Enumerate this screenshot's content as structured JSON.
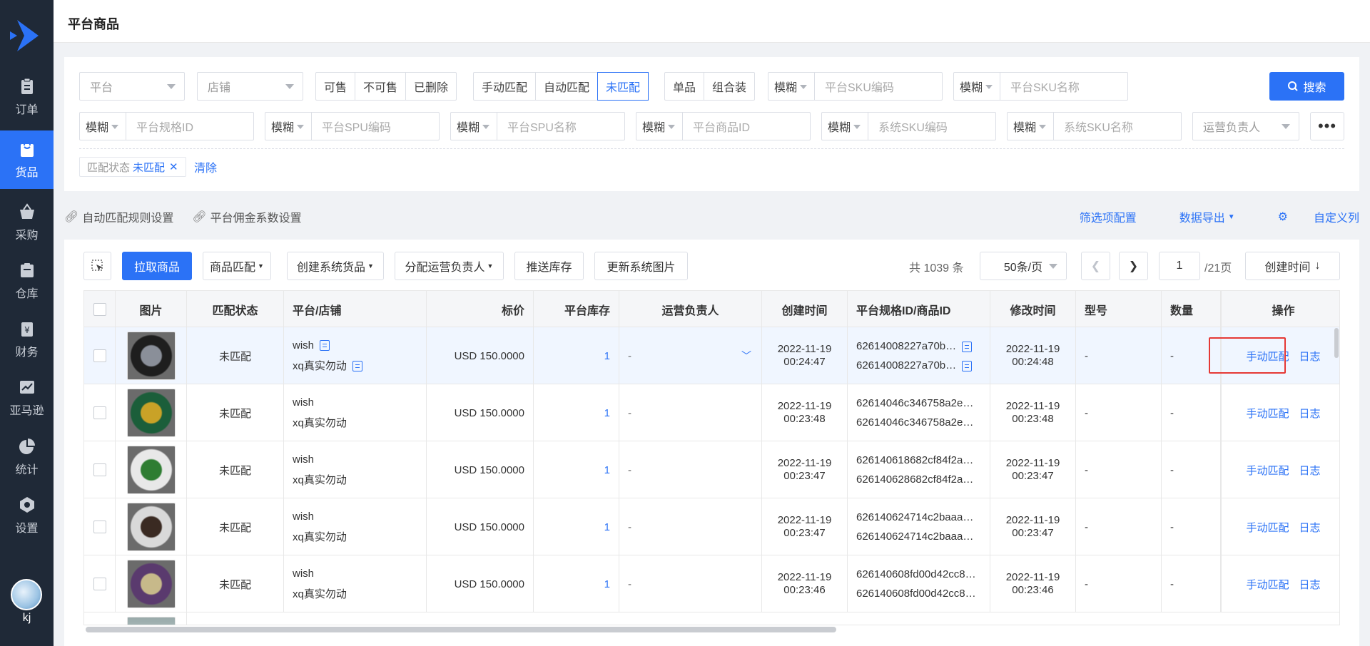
{
  "sidebar": {
    "items": [
      {
        "label": "订单",
        "icon": "clipboard-icon"
      },
      {
        "label": "货品",
        "icon": "bag-icon",
        "active": true
      },
      {
        "label": "采购",
        "icon": "basket-icon"
      },
      {
        "label": "仓库",
        "icon": "warehouse-icon"
      },
      {
        "label": "财务",
        "icon": "finance-icon"
      },
      {
        "label": "亚马逊",
        "icon": "chart-line-icon"
      },
      {
        "label": "统计",
        "icon": "pie-chart-icon"
      },
      {
        "label": "设置",
        "icon": "settings-hex-icon"
      }
    ],
    "user": "kj"
  },
  "header": {
    "title": "平台商品"
  },
  "filters": {
    "platform_placeholder": "平台",
    "store_placeholder": "店铺",
    "sale_status": [
      "可售",
      "不可售",
      "已删除"
    ],
    "match_type": [
      "手动匹配",
      "自动匹配",
      "未匹配"
    ],
    "match_type_active": "未匹配",
    "product_type": [
      "单品",
      "组合装"
    ],
    "fuzzy_label": "模糊",
    "platform_sku_code": "平台SKU编码",
    "platform_sku_name": "平台SKU名称",
    "search_button": "搜索",
    "platform_spec_id": "平台规格ID",
    "platform_spu_code": "平台SPU编码",
    "platform_spu_name": "平台SPU名称",
    "platform_product_id": "平台商品ID",
    "system_sku_code": "系统SKU编码",
    "system_sku_name": "系统SKU名称",
    "operator_placeholder": "运营负责人",
    "more_button": "•••",
    "active_tag_key": "匹配状态",
    "active_tag_value": "未匹配",
    "clear_label": "清除"
  },
  "links": {
    "auto_match_rules": "自动匹配规则设置",
    "commission_settings": "平台佣金系数设置",
    "filter_config": "筛选项配置",
    "data_export": "数据导出",
    "custom_columns": "自定义列"
  },
  "toolbar": {
    "pull_products": "拉取商品",
    "product_match": "商品匹配",
    "create_system_goods": "创建系统货品",
    "assign_operator": "分配运营负责人",
    "push_stock": "推送库存",
    "update_images": "更新系统图片",
    "total": "共 1039 条",
    "page_size": "50条/页",
    "current_page": "1",
    "total_pages": "/21页",
    "sort": "创建时间"
  },
  "table": {
    "columns": [
      "图片",
      "匹配状态",
      "平台/店铺",
      "标价",
      "平台库存",
      "运营负责人",
      "创建时间",
      "平台规格ID/商品ID",
      "修改时间",
      "型号",
      "数量",
      "操作"
    ],
    "rows": [
      {
        "status": "未匹配",
        "platform": "wish",
        "store": "xq真实勿动",
        "price": "USD 150.0000",
        "stock": "1",
        "operator": "-",
        "created_date": "2022-11-19",
        "created_time": "00:24:47",
        "spec_id": "62614008227a70b…",
        "product_id": "62614008227a70b…",
        "modified_date": "2022-11-19",
        "modified_time": "00:24:48",
        "model": "-",
        "qty": "-",
        "op_match": "手动匹配",
        "op_log": "日志",
        "img_colors": [
          "#1e1e1e",
          "#8a8f99"
        ]
      },
      {
        "status": "未匹配",
        "platform": "wish",
        "store": "xq真实勿动",
        "price": "USD 150.0000",
        "stock": "1",
        "operator": "-",
        "created_date": "2022-11-19",
        "created_time": "00:23:48",
        "spec_id": "62614046c346758a2e…",
        "product_id": "62614046c346758a2e…",
        "modified_date": "2022-11-19",
        "modified_time": "00:23:48",
        "model": "-",
        "qty": "-",
        "op_match": "手动匹配",
        "op_log": "日志",
        "img_colors": [
          "#1b5e3a",
          "#c9a227"
        ]
      },
      {
        "status": "未匹配",
        "platform": "wish",
        "store": "xq真实勿动",
        "price": "USD 150.0000",
        "stock": "1",
        "operator": "-",
        "created_date": "2022-11-19",
        "created_time": "00:23:47",
        "spec_id": "626140618682cf84f2a…",
        "product_id": "626140628682cf84f2a…",
        "modified_date": "2022-11-19",
        "modified_time": "00:23:47",
        "model": "-",
        "qty": "-",
        "op_match": "手动匹配",
        "op_log": "日志",
        "img_colors": [
          "#e8e8e8",
          "#2e7d32"
        ]
      },
      {
        "status": "未匹配",
        "platform": "wish",
        "store": "xq真实勿动",
        "price": "USD 150.0000",
        "stock": "1",
        "operator": "-",
        "created_date": "2022-11-19",
        "created_time": "00:23:47",
        "spec_id": "626140624714c2baaa…",
        "product_id": "626140624714c2baaa…",
        "modified_date": "2022-11-19",
        "modified_time": "00:23:47",
        "model": "-",
        "qty": "-",
        "op_match": "手动匹配",
        "op_log": "日志",
        "img_colors": [
          "#d9d9d9",
          "#3a2a22"
        ]
      },
      {
        "status": "未匹配",
        "platform": "wish",
        "store": "xq真实勿动",
        "price": "USD 150.0000",
        "stock": "1",
        "operator": "-",
        "created_date": "2022-11-19",
        "created_time": "00:23:46",
        "spec_id": "626140608fd00d42cc8…",
        "product_id": "626140608fd00d42cc8…",
        "modified_date": "2022-11-19",
        "modified_time": "00:23:46",
        "model": "-",
        "qty": "-",
        "op_match": "手动匹配",
        "op_log": "日志",
        "img_colors": [
          "#5a3a6e",
          "#c7b98a"
        ]
      }
    ]
  },
  "colors": {
    "primary": "#2b72f6",
    "sidebar": "#1f2937",
    "highlight_box": "#e53935"
  }
}
